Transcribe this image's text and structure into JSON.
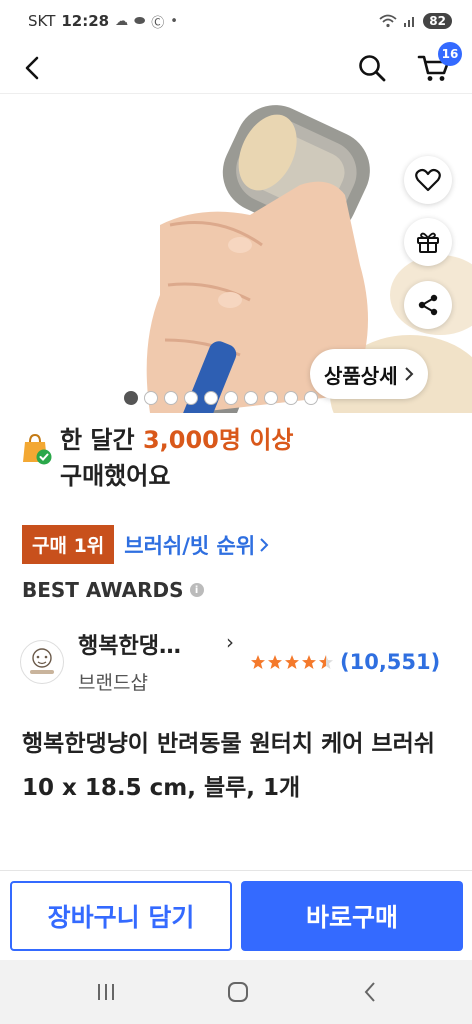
{
  "status_bar": {
    "carrier": "SKT",
    "time": "12:28",
    "battery": "82"
  },
  "header": {
    "cart_count": "16"
  },
  "product_image": {
    "detail_label": "상품상세",
    "dot_count": 10,
    "active_dot": 0
  },
  "purchase_info": {
    "line1_prefix": "한 달간",
    "line1_highlight": "3,000명 이상",
    "line2": "구매했어요"
  },
  "ranking": {
    "badge": "구매 1위",
    "category": "브러쉬/빗 순위"
  },
  "awards": {
    "label": "BEST AWARDS"
  },
  "brand": {
    "name": "행복한댕…",
    "shop": "브랜드샵",
    "rating": 4.5,
    "review_count": "(10,551)"
  },
  "product": {
    "title": "행복한댕냥이 반려동물 원터치 케어 브러쉬 10 x 18.5 cm, 블루, 1개"
  },
  "actions": {
    "add_to_cart": "장바구니 담기",
    "buy_now": "바로구매"
  },
  "colors": {
    "accent_blue": "#346aff",
    "rank_orange": "#c8501c",
    "highlight_orange": "#d9581a"
  }
}
